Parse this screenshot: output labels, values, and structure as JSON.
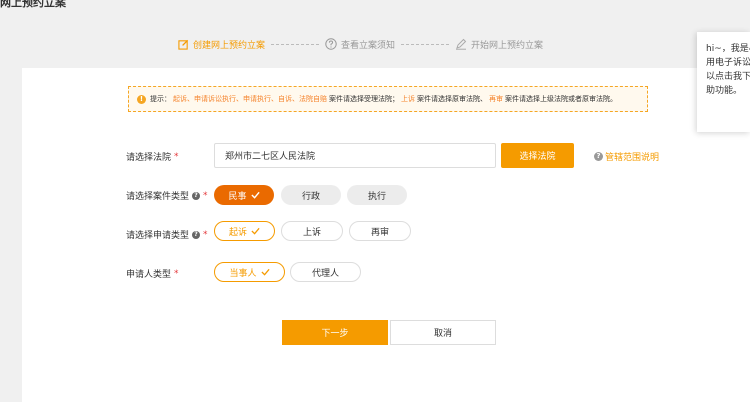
{
  "page": {
    "title": "网上预约立案"
  },
  "steps": [
    {
      "label": "创建网上预约立案",
      "icon": "edit-icon",
      "active": true
    },
    {
      "label": "查看立案须知",
      "icon": "question-circle-icon",
      "active": false
    },
    {
      "label": "开始网上预约立案",
      "icon": "pen-icon",
      "active": false
    }
  ],
  "tip": {
    "prefix": "提示：",
    "part1": "起诉、申请诉讼执行、申请执行、自诉、法院自赔",
    "part2": "案件请选择受理法院；",
    "part3": "上诉",
    "part4": "案件请选择原审法院、",
    "part5": "再审",
    "part6": "案件请选择上级法院或者原审法院。"
  },
  "form": {
    "court": {
      "label": "请选择法院",
      "required": "*",
      "value": "郑州市二七区人民法院",
      "button": "选择法院",
      "scope_link": "管辖范围说明"
    },
    "case_type": {
      "label": "请选择案件类型",
      "required": "*",
      "options": [
        "民事",
        "行政",
        "执行"
      ],
      "selected": "民事"
    },
    "apply_type": {
      "label": "请选择申请类型",
      "required": "*",
      "options": [
        "起诉",
        "上诉",
        "再审"
      ],
      "selected": "起诉"
    },
    "applicant_type": {
      "label": "申请人类型",
      "required": "*",
      "options": [
        "当事人",
        "代理人"
      ],
      "selected": "当事人"
    }
  },
  "actions": {
    "next": "下一步",
    "cancel": "取消"
  },
  "assistant": {
    "lines": [
      "hi~，我是小",
      "用电子诉讼",
      "以点击我下",
      "助功能。"
    ]
  },
  "colors": {
    "accent": "#f59b00",
    "accent_dark": "#ea6a00",
    "required": "#e4393c"
  }
}
